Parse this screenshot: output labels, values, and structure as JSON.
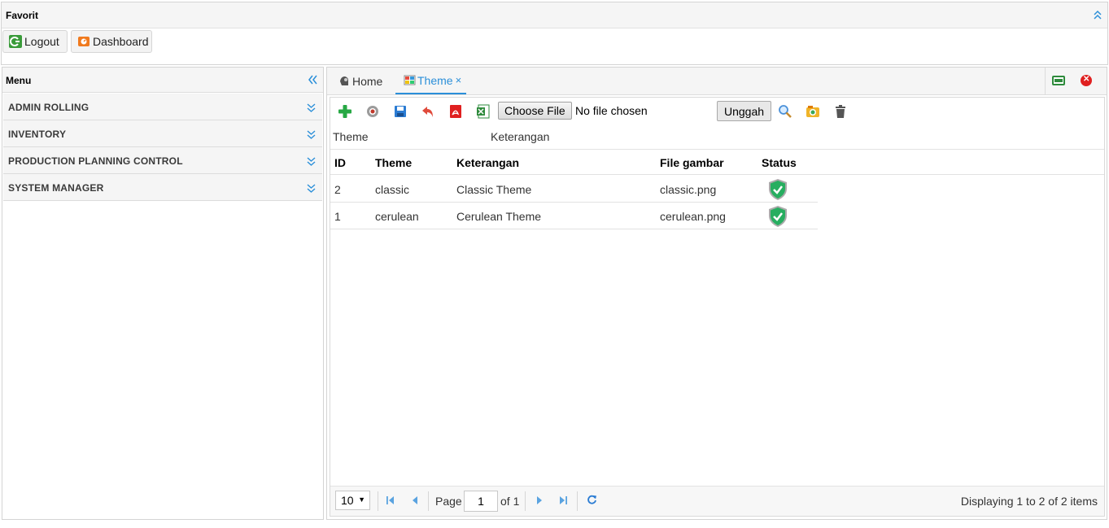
{
  "favorit": {
    "title": "Favorit",
    "buttons": [
      {
        "label": "Logout",
        "icon": "logout-icon"
      },
      {
        "label": "Dashboard",
        "icon": "dashboard-icon"
      }
    ]
  },
  "menu": {
    "title": "Menu",
    "items": [
      {
        "label": "ADMIN ROLLING"
      },
      {
        "label": "INVENTORY"
      },
      {
        "label": "PRODUCTION PLANNING CONTROL"
      },
      {
        "label": "SYSTEM MANAGER"
      }
    ]
  },
  "tabs": [
    {
      "label": "Home",
      "active": false
    },
    {
      "label": "Theme",
      "active": true,
      "close": "×"
    }
  ],
  "toolbar": {
    "icons": [
      "add-icon",
      "view-icon",
      "save-icon",
      "undo-icon",
      "pdf-icon",
      "excel-icon"
    ],
    "file_button": "Choose File",
    "file_status": "No file chosen",
    "upload_button": "Unggah",
    "right_icons": [
      "search-icon",
      "refresh-filter-icon",
      "trash-icon"
    ]
  },
  "filter": {
    "theme_label": "Theme",
    "keterangan_label": "Keterangan"
  },
  "grid": {
    "columns": [
      "ID",
      "Theme",
      "Keterangan",
      "File gambar",
      "Status"
    ],
    "rows": [
      {
        "id": "2",
        "theme": "classic",
        "keterangan": "Classic Theme",
        "file": "classic.png",
        "status": "active"
      },
      {
        "id": "1",
        "theme": "cerulean",
        "keterangan": "Cerulean Theme",
        "file": "cerulean.png",
        "status": "active"
      }
    ]
  },
  "pager": {
    "page_size": "10",
    "page_label": "Page",
    "page_value": "1",
    "of_label": "of 1",
    "display_text": "Displaying 1 to 2 of 2 items"
  },
  "colors": {
    "accent": "#2b8fd9",
    "status_green": "#27ae60"
  }
}
